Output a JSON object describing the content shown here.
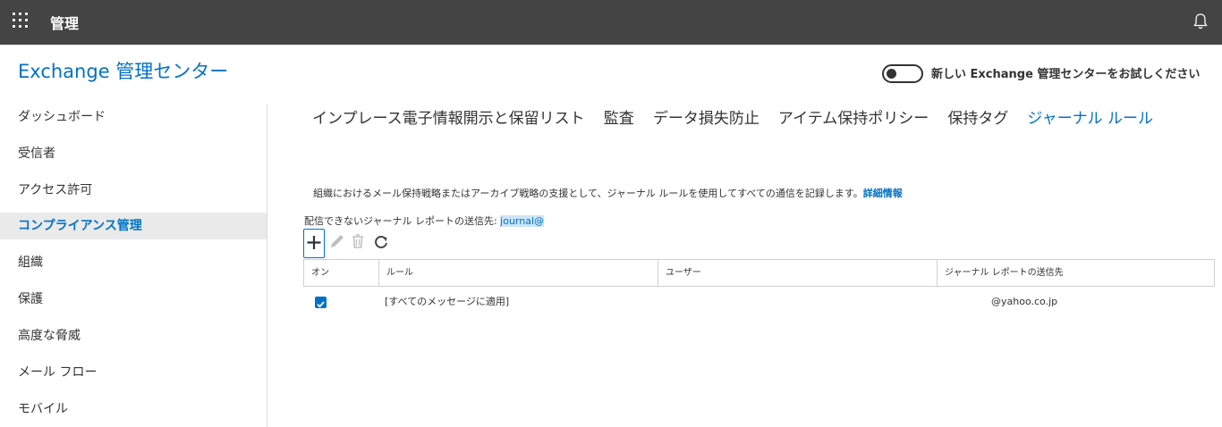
{
  "topbar": {
    "title": "管理"
  },
  "header": {
    "app_title": "Exchange 管理センター",
    "toggle_label": "新しい Exchange 管理センターをお試しください"
  },
  "sidebar": {
    "items": [
      {
        "label": "ダッシュボード"
      },
      {
        "label": "受信者"
      },
      {
        "label": "アクセス許可"
      },
      {
        "label": "コンプライアンス管理"
      },
      {
        "label": "組織"
      },
      {
        "label": "保護"
      },
      {
        "label": "高度な脅威"
      },
      {
        "label": "メール フロー"
      },
      {
        "label": "モバイル"
      }
    ],
    "active_index": 3
  },
  "tabs": [
    {
      "label": "インプレース電子情報開示と保留リスト"
    },
    {
      "label": "監査"
    },
    {
      "label": "データ損失防止"
    },
    {
      "label": "アイテム保持ポリシー"
    },
    {
      "label": "保持タグ"
    },
    {
      "label": "ジャーナル ルール"
    }
  ],
  "main": {
    "description": "組織におけるメール保持戦略またはアーカイブ戦略の支援として、ジャーナル ルールを使用してすべての通信を記録します。",
    "description_link": "詳細情報",
    "recipient_label": "配信できないジャーナル レポートの送信先:",
    "recipient_value": "journal@"
  },
  "toolbar": {
    "icons": [
      "add-icon",
      "edit-icon",
      "delete-icon",
      "refresh-icon"
    ]
  },
  "table": {
    "headers": [
      "オン",
      "ルール",
      "ユーザー",
      "ジャーナル レポートの送信先"
    ],
    "rows": [
      {
        "on": true,
        "rule": "[すべてのメッセージに適用]",
        "user": "",
        "destination": "@yahoo.co.jp"
      }
    ]
  },
  "colors": {
    "accent": "#0072c6",
    "topbar": "#444444"
  }
}
